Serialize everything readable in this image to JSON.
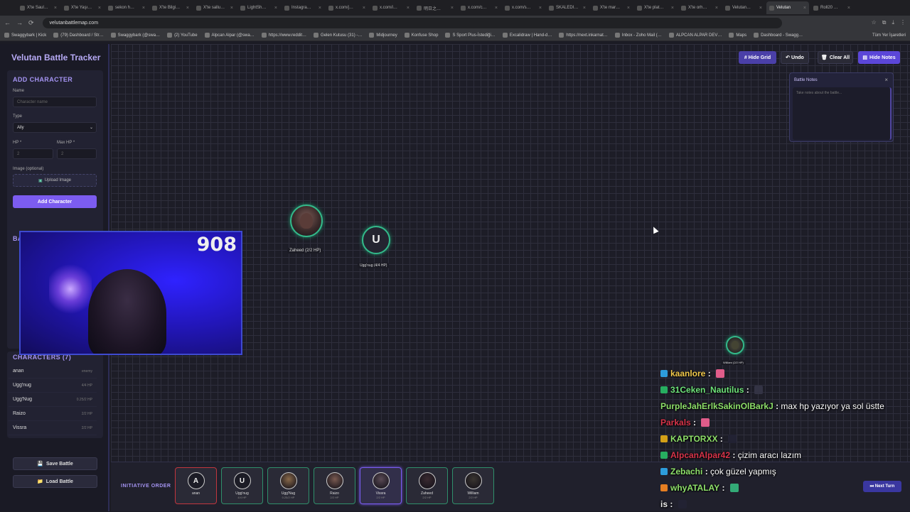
{
  "browser": {
    "tabs": [
      "X'te Saul…",
      "X'te Yaşı…",
      "sekon h…",
      "X'te Bilgi…",
      "X'te sallu…",
      "LightSh…",
      "Instagra…",
      "x.com/j…",
      "x.com/i…",
      "明日之…",
      "x.com/c…",
      "x.com/s…",
      "SKALEDI…",
      "X'te mar…",
      "X'te plat…",
      "X'te orh…",
      "Velutan…",
      "Velutan",
      "Roll20 …"
    ],
    "active_tab_index": 17,
    "url": "velutanbattlemap.com",
    "bookmarks": [
      "Swaggybark | Kick",
      "(79) Dashboard / Str…",
      "Swaggybark (@swa…",
      "(2) YouTube",
      "Alpcan Alpar (@swa…",
      "https://www.reddit…",
      "Gelen Kutusu (31) -…",
      "Midjourney",
      "Konfuse Shop",
      "S Sport Plus-İstediği…",
      "Excalidraw | Hand-d…",
      "https://next.inkarnat…",
      "Inbox - Zoho Mail (…",
      "ALPCAN ALPAR DEV…",
      "Maps",
      "Dashboard - Swagg…"
    ],
    "bookmarks_right": "Tüm Yer İşaretleri"
  },
  "sidebar": {
    "title": "Velutan Battle Tracker",
    "add_character": {
      "heading": "ADD CHARACTER",
      "name_label": "Name",
      "name_placeholder": "Character name",
      "type_label": "Type",
      "type_value": "Ally",
      "hp_label": "HP *",
      "hp_value": "2",
      "maxhp_label": "Max HP *",
      "maxhp_value": "2",
      "image_label": "Image (optional)",
      "upload_label": "Upload Image",
      "add_button": "Add Character"
    },
    "battle_heading_fragment": "BA",
    "characters_heading": "CHARACTERS (7)",
    "characters": [
      {
        "name": "anan",
        "sub": "enemy"
      },
      {
        "name": "Ugg'nug",
        "sub": "4/4 HP"
      },
      {
        "name": "Ugg'Nug",
        "sub": "0.25/2 HP"
      },
      {
        "name": "Raizo",
        "sub": "2/2 HP"
      },
      {
        "name": "Vissra",
        "sub": "2/2 HP"
      }
    ],
    "save_button": "Save Battle",
    "load_button": "Load Battle"
  },
  "map": {
    "buttons": {
      "hide_grid": "# Hide Grid",
      "undo": "↶ Undo",
      "clear_all": "Clear All",
      "hide_notes": "Hide Notes"
    },
    "notes": {
      "title": "Battle Notes",
      "placeholder": "Take notes about the battle..."
    },
    "tokens": [
      {
        "name": "Zaheed",
        "label": "Zaheed (2/2 HP)"
      },
      {
        "name": "Ugg'nug",
        "initial": "U",
        "label": "Ugg'nug (4/4 HP)"
      },
      {
        "name": "William",
        "label": "William (2/2 HP)"
      }
    ]
  },
  "webcam": {
    "viewer_count": "908"
  },
  "initiative": {
    "label": "INITIATIVE ORDER",
    "cards": [
      {
        "initial": "A",
        "name": "anan",
        "hp": "",
        "type": "enemy"
      },
      {
        "initial": "U",
        "name": "Ugg'nug",
        "hp": "4/4 HP",
        "type": "ally"
      },
      {
        "initial": "",
        "name": "Ugg'Nug",
        "hp": "0.25/2 HP",
        "type": "ally"
      },
      {
        "initial": "",
        "name": "Raizo",
        "hp": "2/2 HP",
        "type": "ally"
      },
      {
        "initial": "",
        "name": "Vissra",
        "hp": "2/2 HP",
        "type": "current"
      },
      {
        "initial": "",
        "name": "Zaheed",
        "hp": "2/2 HP",
        "type": "ally"
      },
      {
        "initial": "",
        "name": "William",
        "hp": "2/2 HP",
        "type": "ally"
      }
    ],
    "next_turn": "Next Turn"
  },
  "chat": [
    {
      "user": "kaanlore",
      "color": "#f2c94c",
      "badge": "#2d9cdb",
      "text": "",
      "emote": "#e05c8a"
    },
    {
      "user": "31Ceken_Nautilus",
      "color": "#6ee37a",
      "badge": "#27ae60",
      "text": "",
      "emote": "#334"
    },
    {
      "user": "PurpleJahErlkSakinOlBarkJ",
      "color": "#8ee06a",
      "badge": "",
      "text": "max hp yazıyor ya sol üstte",
      "emote": ""
    },
    {
      "user": "Parkals",
      "color": "#d8344a",
      "badge": "",
      "text": "",
      "emote": "#e05c8a"
    },
    {
      "user": "KAPTORXX",
      "color": "#8ee06a",
      "badge": "#d4a017",
      "text": "",
      "emote": "#223"
    },
    {
      "user": "AlpcanAlpar42",
      "color": "#d8344a",
      "badge": "#27ae60",
      "text": "çizim aracı lazım",
      "emote": ""
    },
    {
      "user": "Zebachi",
      "color": "#8ee06a",
      "badge": "#2d9cdb",
      "text": "çok güzel yapmış",
      "emote": ""
    },
    {
      "user": "whyATALAY",
      "color": "#8ee06a",
      "badge": "#e67e22",
      "text": "",
      "emote": "#3a7"
    },
    {
      "user": "is",
      "color": "#eeeeee",
      "badge": "",
      "text": "",
      "emote": "#223"
    }
  ],
  "colors": {
    "accent": "#7c5cf0",
    "ally": "#33b98a",
    "enemy": "#c2363e"
  }
}
